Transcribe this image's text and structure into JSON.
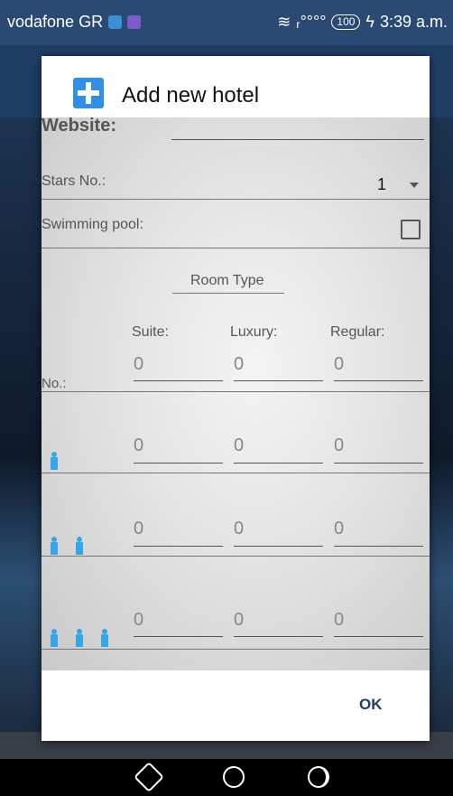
{
  "status_bar": {
    "carrier": "vodafone GR",
    "battery": "100",
    "time": "3:39 a.m.",
    "icons": [
      "square-app-icon",
      "square-app-icon",
      "wifi-icon",
      "signal-icon",
      "battery-icon",
      "charging-icon"
    ]
  },
  "dialog": {
    "title": "Add new hotel",
    "website_label": "Website:",
    "stars_label": "Stars No.:",
    "stars_value": "1",
    "pool_label": "Swimming pool:",
    "pool_checked": false,
    "room_type_label": "Room Type",
    "columns": [
      "Suite:",
      "Luxury:",
      "Regular:"
    ],
    "no_label": "No.:",
    "rows": [
      {
        "values": [
          "0",
          "0",
          "0"
        ],
        "persons": 0
      },
      {
        "values": [
          "0",
          "0",
          "0"
        ],
        "persons": 1
      },
      {
        "values": [
          "0",
          "0",
          "0"
        ],
        "persons": 2
      },
      {
        "values": [
          "0",
          "0",
          "0"
        ],
        "persons": 3
      }
    ],
    "ok_label": "OK"
  },
  "nav_bar": {
    "icons": [
      "back-icon",
      "home-icon",
      "recents-icon"
    ]
  },
  "colors": {
    "accent": "#2e90e6",
    "person": "#35a6e8",
    "ok": "#1f3e66"
  }
}
